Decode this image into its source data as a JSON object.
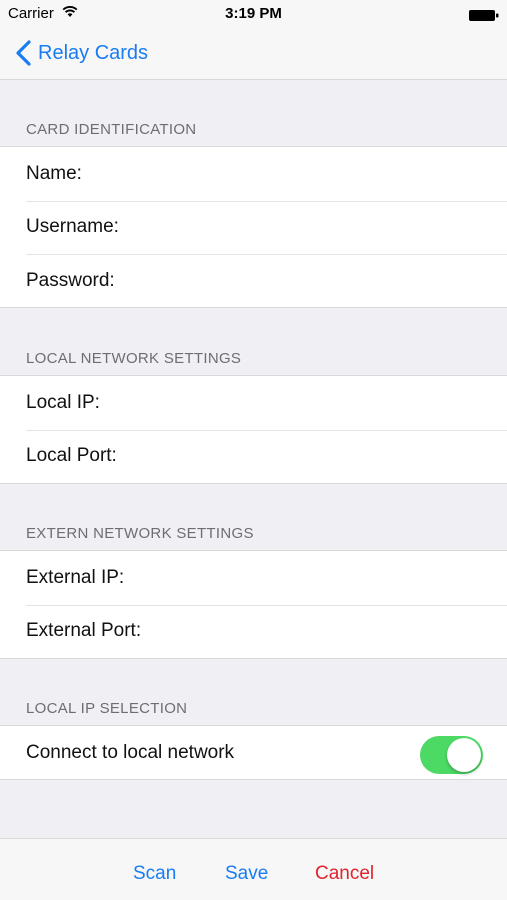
{
  "status_bar": {
    "carrier": "Carrier",
    "time": "3:19 PM"
  },
  "nav": {
    "back_label": "Relay Cards"
  },
  "sections": {
    "card_identification": {
      "header": "CARD IDENTIFICATION",
      "rows": [
        "Name:",
        "Username:",
        "Password:"
      ]
    },
    "local_network": {
      "header": "LOCAL NETWORK SETTINGS",
      "rows": [
        "Local IP:",
        "Local Port:"
      ]
    },
    "extern_network": {
      "header": "EXTERN NETWORK SETTINGS",
      "rows": [
        "External IP:",
        "External Port:"
      ]
    },
    "local_ip_selection": {
      "header": "LOCAL IP SELECTION",
      "toggle_label": "Connect to local network",
      "toggle_on": true
    }
  },
  "toolbar": {
    "scan_label": "Scan",
    "save_label": "Save",
    "cancel_label": "Cancel"
  },
  "colors": {
    "accent": "#1a7cf3",
    "destructive": "#e0242d",
    "toggle_on": "#4cd964",
    "grouped_background": "#efeff4"
  }
}
